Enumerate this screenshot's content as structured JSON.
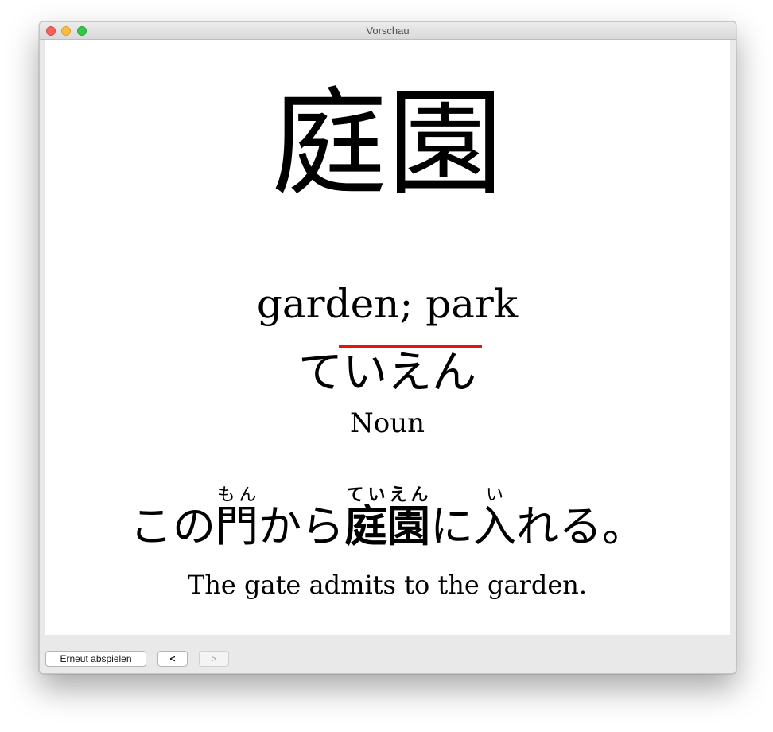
{
  "window": {
    "title": "Vorschau"
  },
  "card": {
    "kanji": "庭園",
    "meaning": "garden; park",
    "reading": "ていえん",
    "part_of_speech": "Noun",
    "example": {
      "pre": "この",
      "w1": {
        "base": "門",
        "ruby": "もん"
      },
      "mid": "から",
      "w2": {
        "base": "庭園",
        "ruby": "ていえん"
      },
      "mid2": "に",
      "w3": {
        "base": "入",
        "ruby": "い"
      },
      "post": "れる。"
    },
    "translation": "The gate admits to the garden."
  },
  "toolbar": {
    "replay_label": "Erneut abspielen",
    "prev_label": "<",
    "next_label": ">"
  },
  "colors": {
    "pitch_accent": "#e3140f"
  }
}
